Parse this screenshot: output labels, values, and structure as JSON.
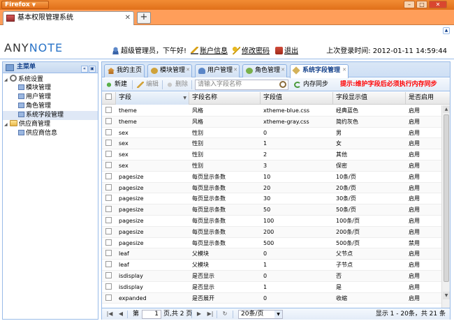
{
  "browser": {
    "app_button": "Firefox",
    "tab_title": "基本权限管理系统",
    "new_tab": "+",
    "minimize": "–",
    "maximize": "□",
    "close": "✕"
  },
  "header": {
    "logo_part1": "ANY",
    "logo_part2": "NOTE",
    "greeting": "超级管理员，下午好!",
    "account_info": "账户信息",
    "change_password": "修改密码",
    "logout": "退出",
    "last_login": "上次登录时间: 2012-01-11 14:59:44"
  },
  "sidebar": {
    "title": "主菜单",
    "tree": [
      {
        "label": "系统设置",
        "level": 0,
        "icon": "gear-icon"
      },
      {
        "label": "模块管理",
        "level": 1,
        "icon": "module-icon"
      },
      {
        "label": "用户管理",
        "level": 1,
        "icon": "user-icon"
      },
      {
        "label": "角色管理",
        "level": 1,
        "icon": "role-icon"
      },
      {
        "label": "系统字段管理",
        "level": 1,
        "icon": "tag-icon"
      },
      {
        "label": "供应商管理",
        "level": 0,
        "icon": "folder-icon"
      },
      {
        "label": "供应商信息",
        "level": 1,
        "icon": "info-icon"
      }
    ]
  },
  "tabs": [
    {
      "label": "我的主页",
      "icon": "home-icon"
    },
    {
      "label": "模块管理",
      "icon": "module-icon"
    },
    {
      "label": "用户管理",
      "icon": "user-icon"
    },
    {
      "label": "角色管理",
      "icon": "role-icon"
    },
    {
      "label": "系统字段管理",
      "icon": "tag-icon"
    }
  ],
  "toolbar": {
    "add": "新建",
    "edit": "编辑",
    "delete": "删除",
    "search_placeholder": "请输入字段名称",
    "sync": "内存同步",
    "warning": "提示:维护字段后必须执行内存同步"
  },
  "grid": {
    "columns": [
      "字段",
      "字段名称",
      "字段值",
      "字段显示值",
      "是否启用"
    ],
    "rows": [
      [
        "theme",
        "风格",
        "xtheme-blue.css",
        "经典蓝色",
        "启用"
      ],
      [
        "theme",
        "风格",
        "xtheme-gray.css",
        "简约灰色",
        "启用"
      ],
      [
        "sex",
        "性别",
        "0",
        "男",
        "启用"
      ],
      [
        "sex",
        "性别",
        "1",
        "女",
        "启用"
      ],
      [
        "sex",
        "性别",
        "2",
        "其他",
        "启用"
      ],
      [
        "sex",
        "性别",
        "3",
        "保密",
        "启用"
      ],
      [
        "pagesize",
        "每页显示条数",
        "10",
        "10条/页",
        "启用"
      ],
      [
        "pagesize",
        "每页显示条数",
        "20",
        "20条/页",
        "启用"
      ],
      [
        "pagesize",
        "每页显示条数",
        "30",
        "30条/页",
        "启用"
      ],
      [
        "pagesize",
        "每页显示条数",
        "50",
        "50条/页",
        "启用"
      ],
      [
        "pagesize",
        "每页显示条数",
        "100",
        "100条/页",
        "启用"
      ],
      [
        "pagesize",
        "每页显示条数",
        "200",
        "200条/页",
        "启用"
      ],
      [
        "pagesize",
        "每页显示条数",
        "500",
        "500条/页",
        "禁用"
      ],
      [
        "leaf",
        "父模块",
        "0",
        "父节点",
        "启用"
      ],
      [
        "leaf",
        "父模块",
        "1",
        "子节点",
        "启用"
      ],
      [
        "isdisplay",
        "是否显示",
        "0",
        "否",
        "启用"
      ],
      [
        "isdisplay",
        "是否显示",
        "1",
        "是",
        "启用"
      ],
      [
        "expanded",
        "是否展开",
        "0",
        "收缩",
        "启用"
      ]
    ]
  },
  "pager": {
    "page_prefix": "第",
    "current_page": "1",
    "page_suffix": "页,共 2 页",
    "page_size": "20条/页",
    "summary": "显示 1 - 20条，共 21 条"
  }
}
